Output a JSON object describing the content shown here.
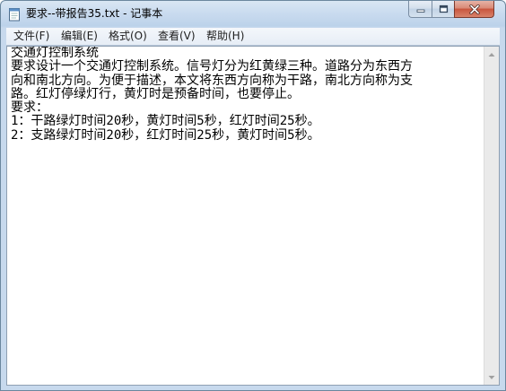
{
  "window": {
    "title": "要求--带报告35.txt - 记事本",
    "app_icon": "notepad-icon",
    "caption_buttons": [
      "minimize-icon",
      "maximize-icon",
      "close-icon"
    ]
  },
  "menu": {
    "items": [
      {
        "label": "文件(F)"
      },
      {
        "label": "编辑(E)"
      },
      {
        "label": "格式(O)"
      },
      {
        "label": "查看(V)"
      },
      {
        "label": "帮助(H)"
      }
    ]
  },
  "document": {
    "lines": [
      "交通灯控制系统",
      "要求设计一个交通灯控制系统。信号灯分为红黄绿三种。道路分为东西方",
      "向和南北方向。为便于描述，本文将东西方向称为干路，南北方向称为支",
      "路。红灯停绿灯行，黄灯时是预备时间，也要停止。",
      "要求：",
      "1：干路绿灯时间20秒，黄灯时间5秒，红灯时间25秒。",
      "2：支路绿灯时间20秒，红灯时间25秒，黄灯时间5秒。"
    ]
  },
  "scrollbar": {
    "up_icon": "scroll-up-arrow-icon",
    "down_icon": "scroll-down-arrow-icon"
  }
}
